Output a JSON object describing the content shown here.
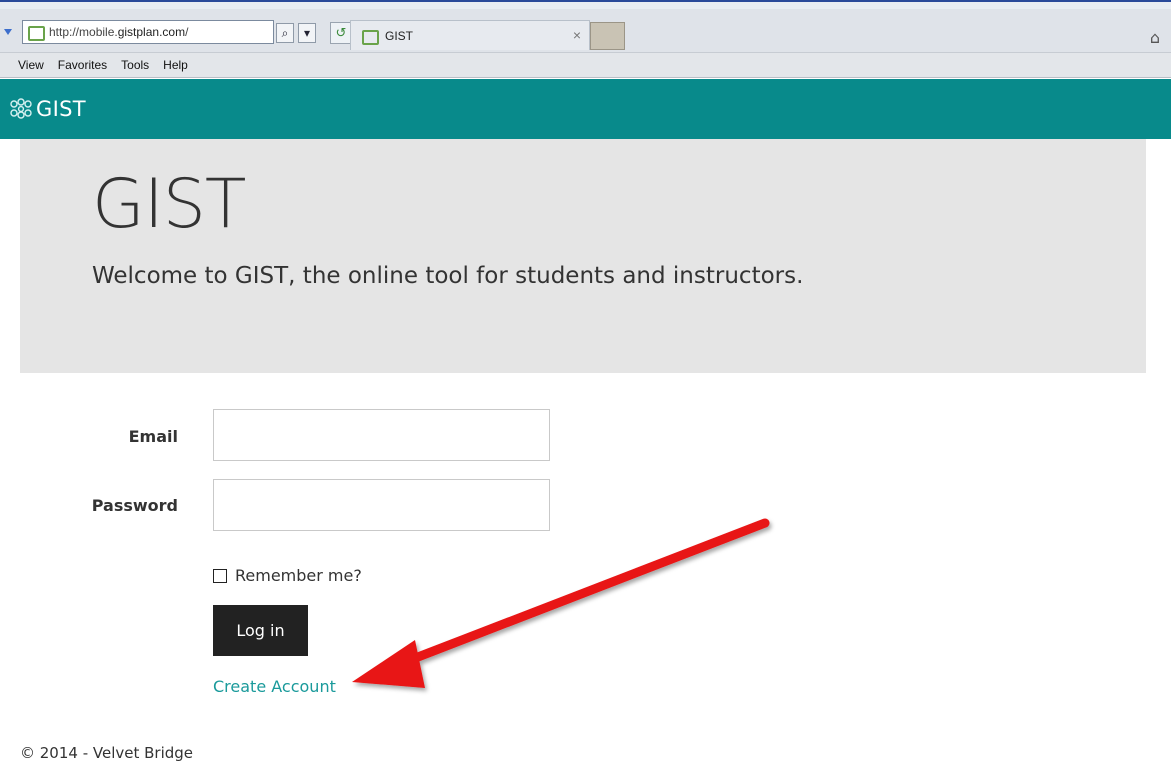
{
  "browser": {
    "url_prefix": "http://mobile.",
    "url_host": "gistplan.com",
    "url_suffix": "/",
    "tab_title": "GIST",
    "tab_close": "×",
    "search_glyph": "⌕",
    "dropdown_glyph": "▾",
    "refresh_glyph": "↺",
    "home_glyph": "⌂",
    "menu": [
      "View",
      "Favorites",
      "Tools",
      "Help"
    ]
  },
  "navbar": {
    "brand": "GIST",
    "color": "#088a8b"
  },
  "jumbotron": {
    "title": "GIST",
    "lead": "Welcome to GIST, the online tool for students and instructors."
  },
  "form": {
    "email_label": "Email",
    "email_value": "",
    "password_label": "Password",
    "password_value": "",
    "remember_label": "Remember me?",
    "remember_checked": false,
    "login_label": "Log in",
    "create_account_label": "Create Account"
  },
  "footer": {
    "text": "© 2014 - Velvet Bridge"
  },
  "annotation": {
    "arrow_color": "#e81414",
    "arrow_target": "create-account-link"
  }
}
